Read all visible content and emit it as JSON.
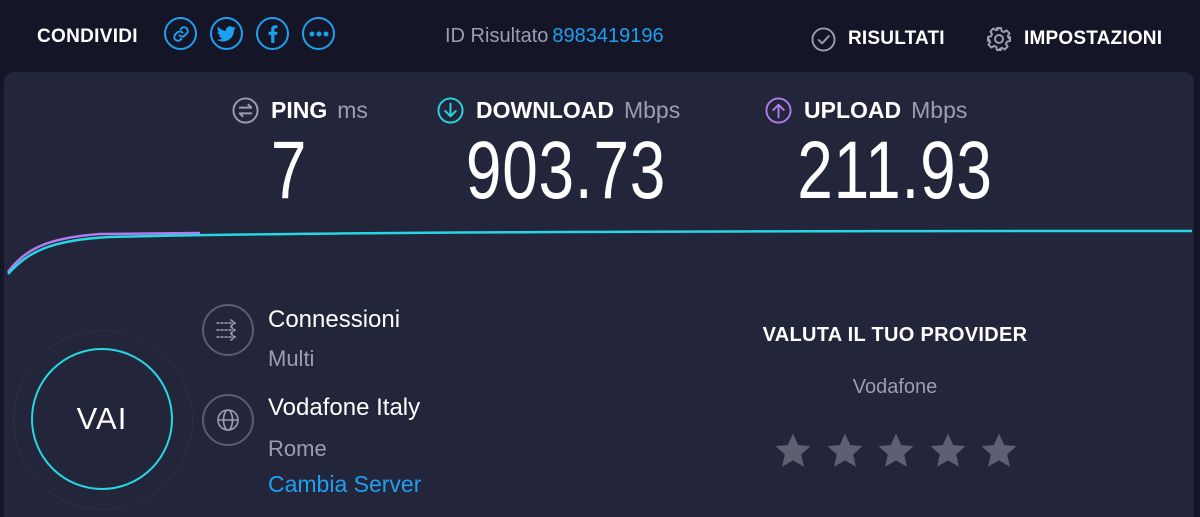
{
  "header": {
    "share_label": "CONDIVIDI",
    "share_buttons": [
      {
        "icon": "link-icon"
      },
      {
        "icon": "twitter-icon"
      },
      {
        "icon": "facebook-icon"
      },
      {
        "icon": "more-icon"
      }
    ],
    "result_id_label": "ID Risultato",
    "result_id_value": "8983419196",
    "results_label": "RISULTATI",
    "settings_label": "IMPOSTAZIONI"
  },
  "metrics": {
    "ping": {
      "name": "PING",
      "unit": "ms",
      "value": "7",
      "icon": "ping-icon"
    },
    "download": {
      "name": "DOWNLOAD",
      "unit": "Mbps",
      "value": "903.73",
      "icon": "download-icon"
    },
    "upload": {
      "name": "UPLOAD",
      "unit": "Mbps",
      "value": "211.93",
      "icon": "upload-icon"
    }
  },
  "go_button_label": "VAI",
  "connection": {
    "title": "Connessioni",
    "mode": "Multi",
    "icon": "connections-icon"
  },
  "server": {
    "provider": "Vodafone Italy",
    "location": "Rome",
    "change_label": "Cambia Server",
    "icon": "globe-icon"
  },
  "rating": {
    "title": "VALUTA IL TUO PROVIDER",
    "provider": "Vodafone",
    "stars_total": 5,
    "stars_selected": 0
  },
  "colors": {
    "background": "#141526",
    "panel": "#23253a",
    "accent_blue": "#1ea0f0",
    "download_cyan": "#27d6e2",
    "upload_purple": "#b07cf0",
    "muted_text": "#9b9db3",
    "star_gray": "#5d5f72"
  }
}
